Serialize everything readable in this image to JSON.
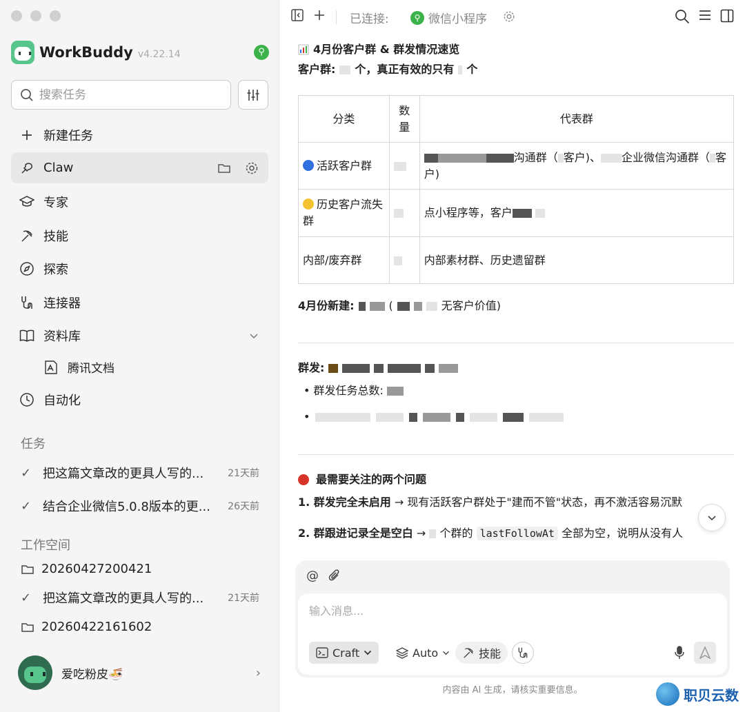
{
  "sidebar": {
    "brand": {
      "name": "WorkBuddy",
      "version": "v4.22.14"
    },
    "search_placeholder": "搜索任务",
    "nav": [
      {
        "label": "新建任务",
        "icon": "plus-icon"
      },
      {
        "label": "Claw",
        "icon": "claw-icon"
      },
      {
        "label": "专家",
        "icon": "graduation-cap-icon"
      },
      {
        "label": "技能",
        "icon": "pickaxe-icon"
      },
      {
        "label": "探索",
        "icon": "compass-icon"
      },
      {
        "label": "连接器",
        "icon": "connector-icon"
      },
      {
        "label": "资料库",
        "icon": "book-icon"
      },
      {
        "label": "自动化",
        "icon": "clock-icon"
      }
    ],
    "library_sub": "腾讯文档",
    "tasks_label": "任务",
    "tasks": [
      {
        "title": "把这篇文章改的更具人写的...",
        "time": "21天前"
      },
      {
        "title": "结合企业微信5.0.8版本的更...",
        "time": "26天前"
      }
    ],
    "workspace_label": "工作空间",
    "workspaces": [
      {
        "name": "20260427200421"
      },
      {
        "name": "20260422161602"
      }
    ],
    "workspace_task": {
      "title": "把这篇文章改的更具人写的...",
      "time": "21天前"
    },
    "user": {
      "name": "爱吃粉皮🍜"
    }
  },
  "topbar": {
    "connected_label": "已连接:",
    "mini_program": "微信小程序"
  },
  "content": {
    "heading": "4月份客户群 & 群发情况速览",
    "group_line_prefix": "客户群:",
    "group_line_mid": "个，真正有效的只有",
    "group_line_suffix": "个",
    "table": {
      "headers": [
        "分类",
        "数量",
        "代表群"
      ],
      "rows": [
        {
          "category": "活跃客户群",
          "dot": "#2f6fe0",
          "rep_a": "沟通群（",
          "rep_b": "客户)、",
          "rep_c": "企业微信沟通群（",
          "rep_d": "客户)"
        },
        {
          "category": "历史客户流失群",
          "dot": "#f2c230",
          "rep_a": "点小程序等，客户"
        },
        {
          "category": "内部/废弃群",
          "rep_a": "内部素材群、历史遗留群"
        }
      ]
    },
    "april_new_prefix": "4月份新建:",
    "april_new_suffix": "无客户价值)",
    "mass_label": "群发:",
    "mass_total_label": "群发任务总数:",
    "issues_heading": "最需要关注的两个问题",
    "issue1_bold": "1. 群发完全未启用",
    "issue1_rest": "→ 现有活跃客户群处于\"建而不管\"状态，再不激活容易沉默",
    "issue2_bold": "2. 群跟进记录全是空白",
    "issue2_mid": "→",
    "issue2_mid2": "个群的",
    "issue2_code": "lastFollowAt",
    "issue2_rest": "全部为空，说明从没有人"
  },
  "composer": {
    "placeholder": "输入消息...",
    "mode": "Craft",
    "model": "Auto",
    "skills": "技能"
  },
  "footer": {
    "disclaimer": "内容由 AI 生成，请核实重要信息。",
    "watermark": "职贝云数"
  },
  "colors": {
    "brand_green": "#58c58d",
    "link_green": "#3cb34a",
    "red_dot": "#d9342b"
  }
}
